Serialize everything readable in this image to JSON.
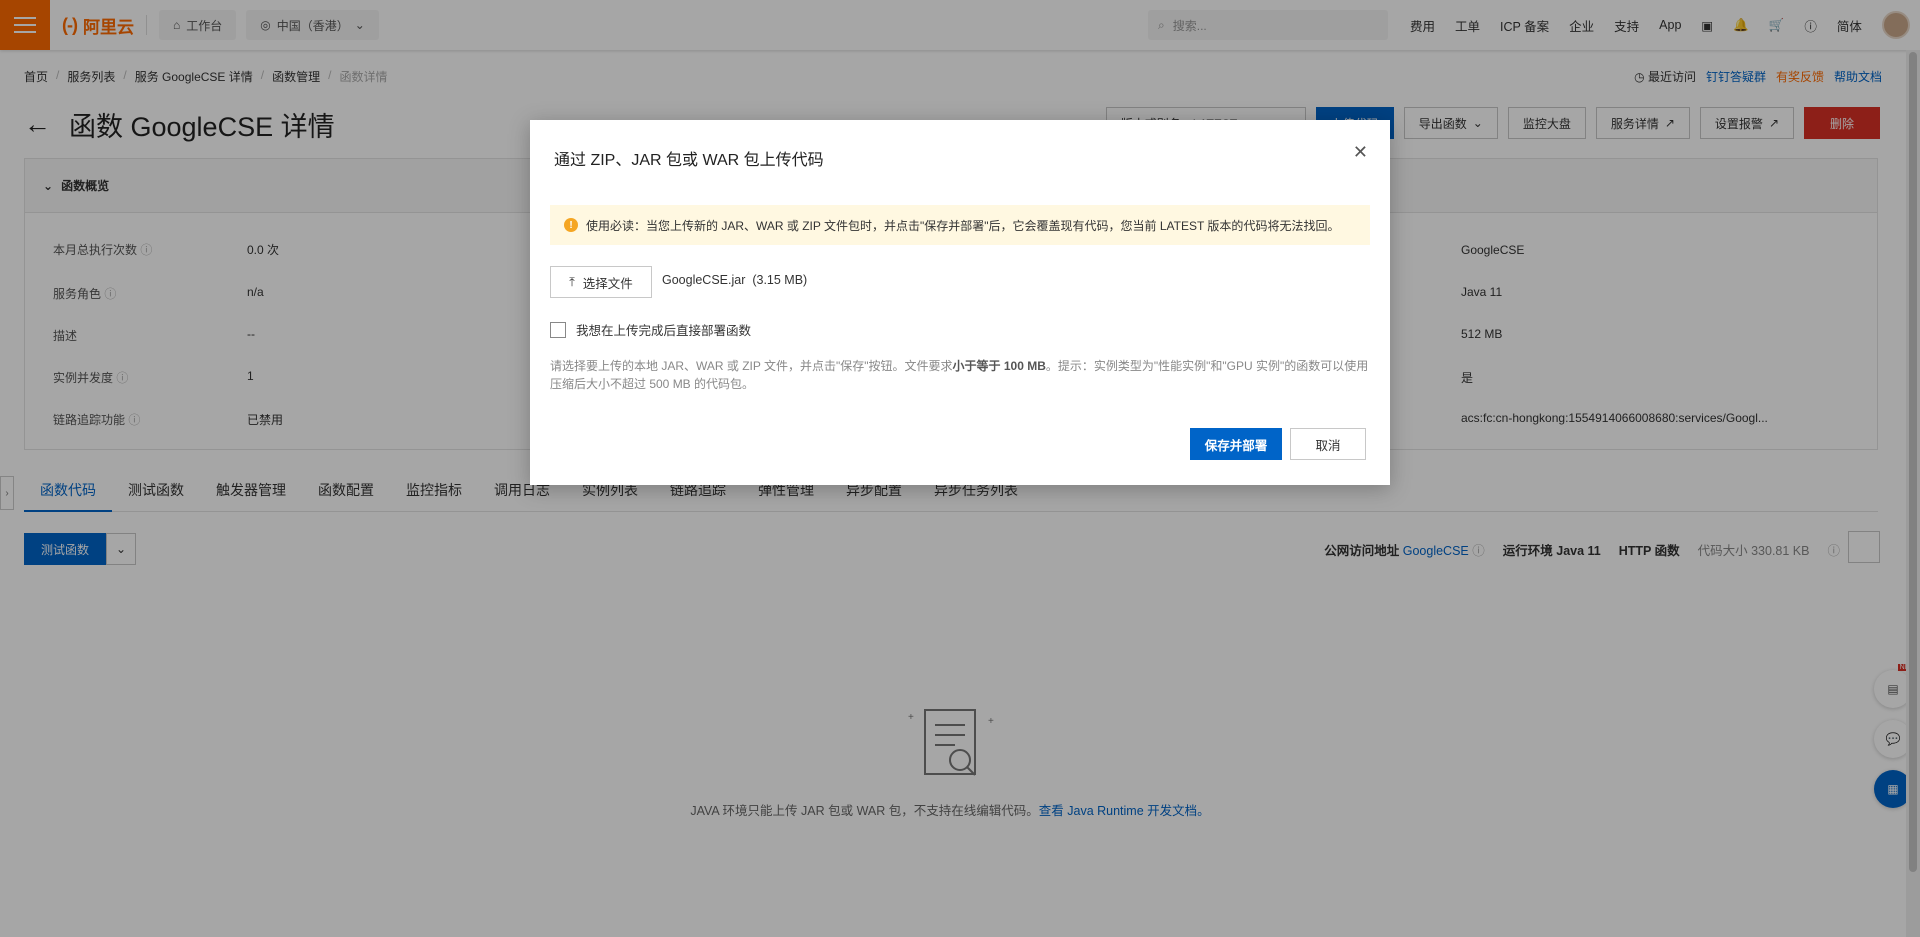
{
  "topbar": {
    "logo_text": "阿里云",
    "logo_mark": "(-)",
    "workbench": "工作台",
    "region": "中国（香港）",
    "search_placeholder": "搜索...",
    "links": [
      "费用",
      "工单",
      "ICP 备案",
      "企业",
      "支持",
      "App"
    ],
    "lang": "简体"
  },
  "breadcrumb": [
    "首页",
    "服务列表",
    "服务 GoogleCSE 详情",
    "函数管理",
    "函数详情"
  ],
  "right_links": {
    "recent": "最近访问",
    "dingtalk": "钉钉答疑群",
    "reward": "有奖反馈",
    "help": "帮助文档"
  },
  "page_title": "函数 GoogleCSE 详情",
  "toolbar": {
    "version_select": "版本或别名：LATEST",
    "upload": "上传代码",
    "export": "导出函数",
    "monitor": "监控大盘",
    "service_detail": "服务详情",
    "alarm": "设置报警",
    "delete": "删除"
  },
  "overview": {
    "header": "函数概览",
    "rows": [
      {
        "label": "本月总执行次数",
        "value": "0.0 次"
      },
      {
        "label": "服务角色",
        "value": "n/a"
      },
      {
        "label": "描述",
        "value": "--"
      },
      {
        "label": "实例并发度",
        "value": "1"
      },
      {
        "label": "链路追踪功能",
        "value": "已禁用"
      }
    ],
    "right_values": [
      "GoogleCSE",
      "Java 11",
      "512 MB",
      "是",
      "acs:fc:cn-hongkong:1554914066008680:services/Googl..."
    ]
  },
  "tabs": [
    "函数代码",
    "测试函数",
    "触发器管理",
    "函数配置",
    "监控指标",
    "调用日志",
    "实例列表",
    "链路追踪",
    "弹性管理",
    "异步配置",
    "异步任务列表"
  ],
  "test_button": "测试函数",
  "info": {
    "public_label": "公网访问地址",
    "public_value": "GoogleCSE",
    "runtime": "运行环境 Java 11",
    "http": "HTTP 函数",
    "code_size": "代码大小 330.81 KB"
  },
  "empty_state": {
    "text": "JAVA 环境只能上传 JAR 包或 WAR 包，不支持在线编辑代码。",
    "link": "查看 Java Runtime 开发文档。"
  },
  "dialog": {
    "title": "通过 ZIP、JAR 包或 WAR 包上传代码",
    "notice": "使用必读：当您上传新的 JAR、WAR 或 ZIP 文件包时，并点击\"保存并部署\"后，它会覆盖现有代码，您当前 LATEST 版本的代码将无法找回。",
    "choose_file": "选择文件",
    "file_name": "GoogleCSE.jar",
    "file_size": "(3.15 MB)",
    "checkbox_label": "我想在上传完成后直接部署函数",
    "help_text_1": "请选择要上传的本地 JAR、WAR 或 ZIP 文件，并点击\"保存\"按钮。文件要求",
    "help_bold": "小于等于 100 MB",
    "help_text_2": "。提示：实例类型为\"性能实例\"和\"GPU 实例\"的函数可以使用压缩后大小不超过 500 MB 的代码包。",
    "save_deploy": "保存并部署",
    "cancel": "取消"
  },
  "badge_new": "NEW"
}
